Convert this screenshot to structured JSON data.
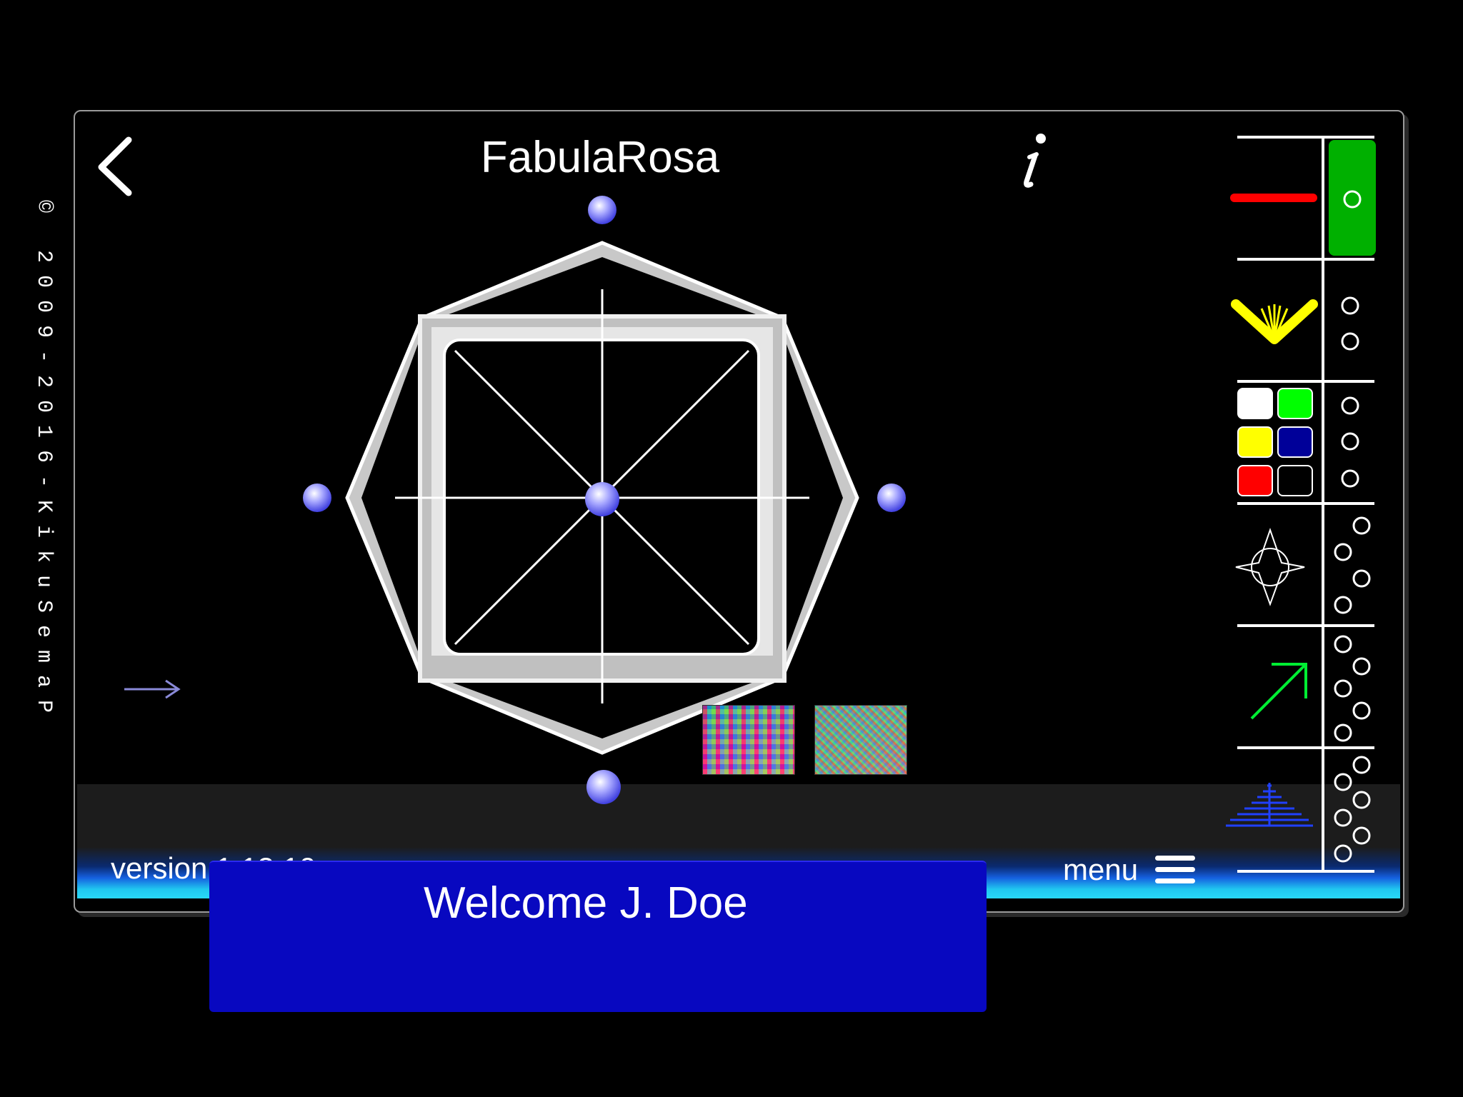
{
  "copyright": "© 2009-2016-KikuSemaP",
  "header": {
    "title": "FabulaRosa",
    "back_icon": "chevron-left-icon",
    "info_icon": "info-italic-icon"
  },
  "footer": {
    "version": "version 1.13.10",
    "menu_label": "menu"
  },
  "welcome": {
    "text": "Welcome J. Doe",
    "bg_color": "#0808c0"
  },
  "toolbar": {
    "line_color": "#ff0000",
    "selected_color": "#00b000",
    "colors": [
      "#ffffff",
      "#00ff00",
      "#ffff00",
      "#000099",
      "#ff0000",
      "#000000"
    ],
    "arrow_color": "#00ee33",
    "fan_color": "#ffff00",
    "pyramid_color": "#2040ff"
  },
  "shape": {
    "handle_color": "#6a6aff"
  }
}
